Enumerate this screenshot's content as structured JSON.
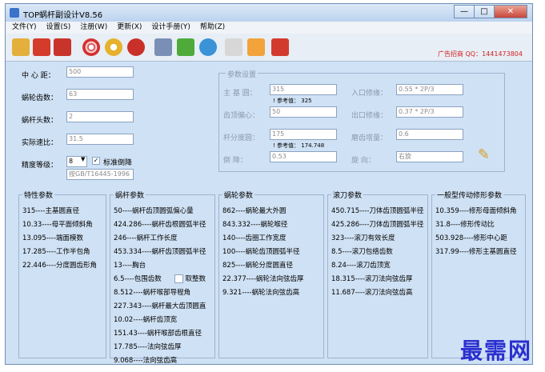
{
  "window": {
    "title": "TOP蜗杆副设计V8.56",
    "minimize": "—",
    "maximize": "□",
    "close": "✕"
  },
  "menu": [
    "文件(Y)",
    "设置(S)",
    "注册(W)",
    "更新(X)",
    "设计手册(Y)",
    "帮助(Z)"
  ],
  "toolbar": {
    "icons": [
      "open-icon",
      "save-icon",
      "spiral-icon",
      "gear-icon",
      "tool-icon",
      "calc-icon",
      "green-b-icon",
      "cloud-icon",
      "edit-doc-icon",
      "rss-icon",
      "exit-icon"
    ],
    "ad": "广告招商 QQ：1441473804"
  },
  "left": {
    "center_distance": {
      "label": "中 心 距：",
      "value": "500"
    },
    "worm_wheel_teeth": {
      "label": "蜗轮齿数：",
      "value": "63"
    },
    "worm_starts": {
      "label": "蜗杆头数：",
      "value": "2"
    },
    "actual_ratio": {
      "label": "实际速比：",
      "value": "31.5"
    },
    "precision": {
      "label": "精度等级：",
      "value": "8"
    },
    "chamfer_checkbox": {
      "label": "标准倒降",
      "checked": true
    },
    "standard": "按GB/T16445-1996"
  },
  "params": {
    "title": "参数设置",
    "base_circle": {
      "label": "主 基 圆：",
      "value": "315",
      "ref": "! 参考值： 325"
    },
    "tooth_offset": {
      "label": "齿顶偏心：",
      "value": "50"
    },
    "arc_radius": {
      "label": "杆分度圆：",
      "value": "175",
      "ref": "! 参考值： 174.748"
    },
    "chamfer": {
      "label": "倒    降：",
      "value": "0.53"
    },
    "entry_mod": {
      "label": "入口修缘：",
      "value": "0.55 * 2P/3"
    },
    "exit_mod": {
      "label": "出口修缘：",
      "value": "0.37 * 2P/3"
    },
    "tooth_increase": {
      "label": "磨齿增量：",
      "value": "0.6"
    },
    "rotation": {
      "label": "旋    向：",
      "value": "右旋"
    }
  },
  "columns": [
    {
      "title": "特性参数",
      "items": [
        "315----主基圆直径",
        "10.33----母平面倾斜角",
        "13.095----端面模数",
        "17.285----工作半包角",
        "22.446----分度圆齿形角"
      ]
    },
    {
      "title": "蜗杆参数",
      "items": [
        "50----蜗杆齿顶圆弧偏心量",
        "424.286----蜗杆齿根圆弧半径",
        "246----蜗杆工作长度",
        "453.334----蜗杆齿顶圆弧半径",
        "13----胸台",
        "6.5----包围齿数",
        "8.512----蜗杆喉部导程角",
        "227.343----蜗杆最大齿顶圆直",
        "10.02----蜗杆齿顶宽",
        "151.43----蜗杆喉部齿根直径",
        "17.785----法向弦齿厚",
        "9.068----法向弦齿高"
      ],
      "checkbox": "取整数"
    },
    {
      "title": "蜗轮参数",
      "items": [
        "862----蜗轮最大外圆",
        "843.332----蜗轮喉径",
        "140----齿圈工作宽度",
        "100----蜗轮齿顶圆弧半径",
        "825----蜗轮分度圆直径",
        "22.377----蜗轮法向弦齿厚",
        "9.321----蜗轮法向弦齿高"
      ]
    },
    {
      "title": "滚刀参数",
      "items": [
        "450.715----刀体齿顶圆弧半径",
        "425.286----刀体齿顶圆弧半径",
        "323----滚刀有效长度",
        "8.5----滚刀包络齿数",
        "8.24----滚刀齿顶宽",
        "18.315----滚刀法向弦齿厚",
        "11.687----滚刀法向弦齿高"
      ]
    },
    {
      "title": "一般型传动修形参数",
      "items": [
        "10.359----修形母面倾斜角",
        "31.8----修形传动比",
        "503.928----修形中心距",
        "317.99----修形主基圆直径"
      ]
    }
  ],
  "watermark": "最需网"
}
